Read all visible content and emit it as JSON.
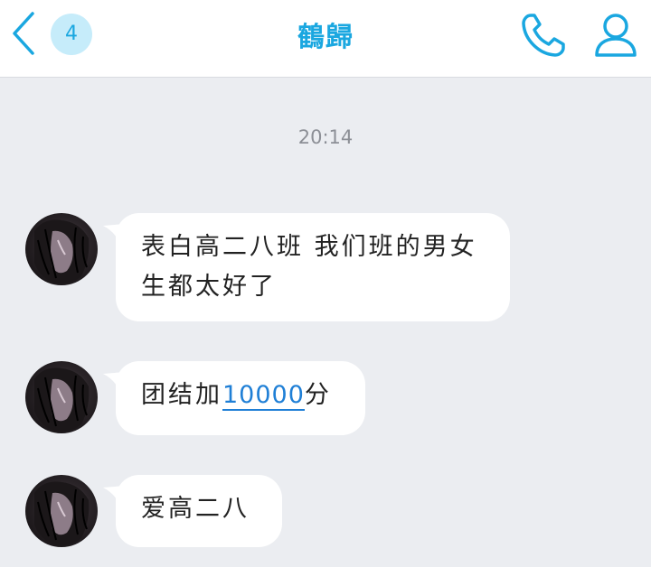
{
  "header": {
    "unread_count": "4",
    "title": "鶴歸"
  },
  "chat": {
    "timestamp": "20:14",
    "messages": [
      {
        "text": "表白高二八班 我们班的男女生都太好了"
      },
      {
        "text_before": "团结加",
        "link_number": "10000",
        "text_after": "分"
      },
      {
        "text": "爱高二八"
      }
    ]
  },
  "icons": {
    "back": "chevron-left-icon",
    "call": "phone-icon",
    "profile": "person-icon"
  },
  "colors": {
    "accent": "#1aa7e0",
    "badge_bg": "#c6ecfa",
    "chat_bg": "#ebedf1",
    "bubble_bg": "#ffffff",
    "link": "#1f7fd6"
  }
}
